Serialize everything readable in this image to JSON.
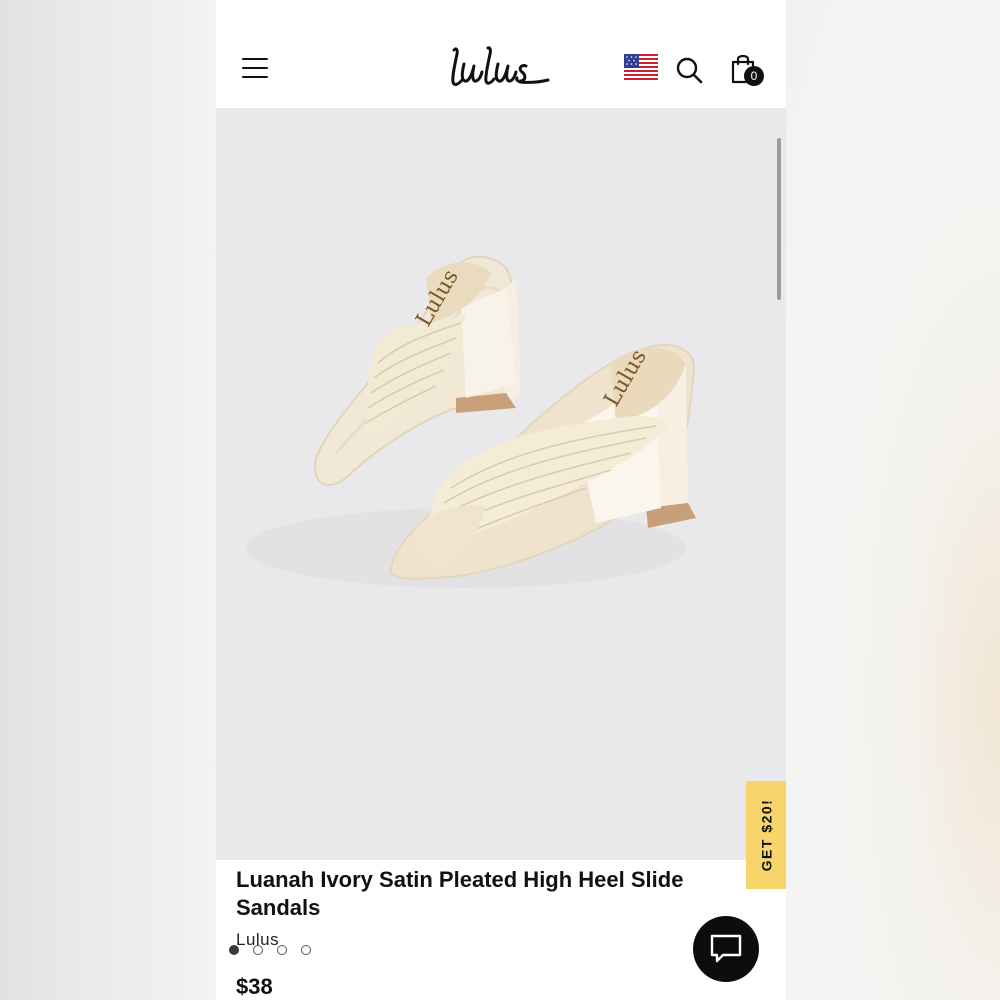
{
  "header": {
    "logo_text": "Lulus",
    "cart_count": "0",
    "icons": [
      "hamburger-menu-icon",
      "us-flag-icon",
      "search-icon",
      "shopping-bag-icon"
    ]
  },
  "gallery": {
    "image_count": 4,
    "active_index": 0,
    "insole_brand_text": "Lulus"
  },
  "promo": {
    "label": "GET $20!",
    "color": "#f8d56b"
  },
  "product": {
    "title": "Luanah Ivory Satin Pleated High Heel Slide Sandals",
    "brand": "Lulus",
    "price": "$38"
  },
  "chat": {
    "icon": "chat-bubble-icon"
  }
}
